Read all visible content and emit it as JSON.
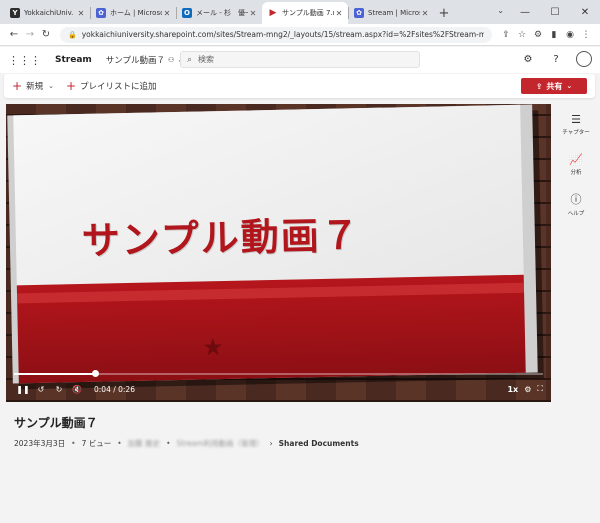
{
  "browser": {
    "tabs": [
      {
        "title": "YokkaichiUniv. C",
        "favicon_color": "#2d2d2d",
        "glyph": "Y",
        "active": false
      },
      {
        "title": "ホーム | Microsoft",
        "favicon_color": "#4b63d3",
        "glyph": "✿",
        "active": false
      },
      {
        "title": "メール - 杉　優一",
        "favicon_color": "#0f6cbd",
        "glyph": "O",
        "active": false
      },
      {
        "title": "サンプル動画 7.m",
        "favicon_color": "#c4262e",
        "glyph": "▶",
        "active": true
      },
      {
        "title": "Stream | Microso",
        "favicon_color": "#4b63d3",
        "glyph": "✿",
        "active": false
      }
    ],
    "new_tab_icon": "+",
    "url": "yokkaichiuniversity.sharepoint.com/sites/Stream-mng2/_layouts/15/stream.aspx?id=%2Fsites%2FStream-mng2..."
  },
  "header": {
    "app_name": "Stream",
    "document_title": "サンプル動画７",
    "search_placeholder": "検索"
  },
  "commandbar": {
    "new_label": "新規",
    "add_playlist_label": "プレイリストに追加",
    "share_label": "共有"
  },
  "video": {
    "slide_text": "サンプル動画７",
    "current_time": "0:04",
    "duration": "0:26",
    "time_display": "0:04 / 0:26",
    "progress_fraction": 0.154,
    "speed": "1x"
  },
  "rail": {
    "chapters_label": "チャプター",
    "analytics_label": "分析",
    "help_label": "ヘルプ"
  },
  "info": {
    "title": "サンプル動画７",
    "date": "2023年3月3日",
    "views": "7 ビュー",
    "owner": "加藤 雅史",
    "site": "Stream利用動画（管理）",
    "library": "Shared Documents"
  },
  "colors": {
    "accent": "#c4262e",
    "slide_red": "#b1161c"
  }
}
